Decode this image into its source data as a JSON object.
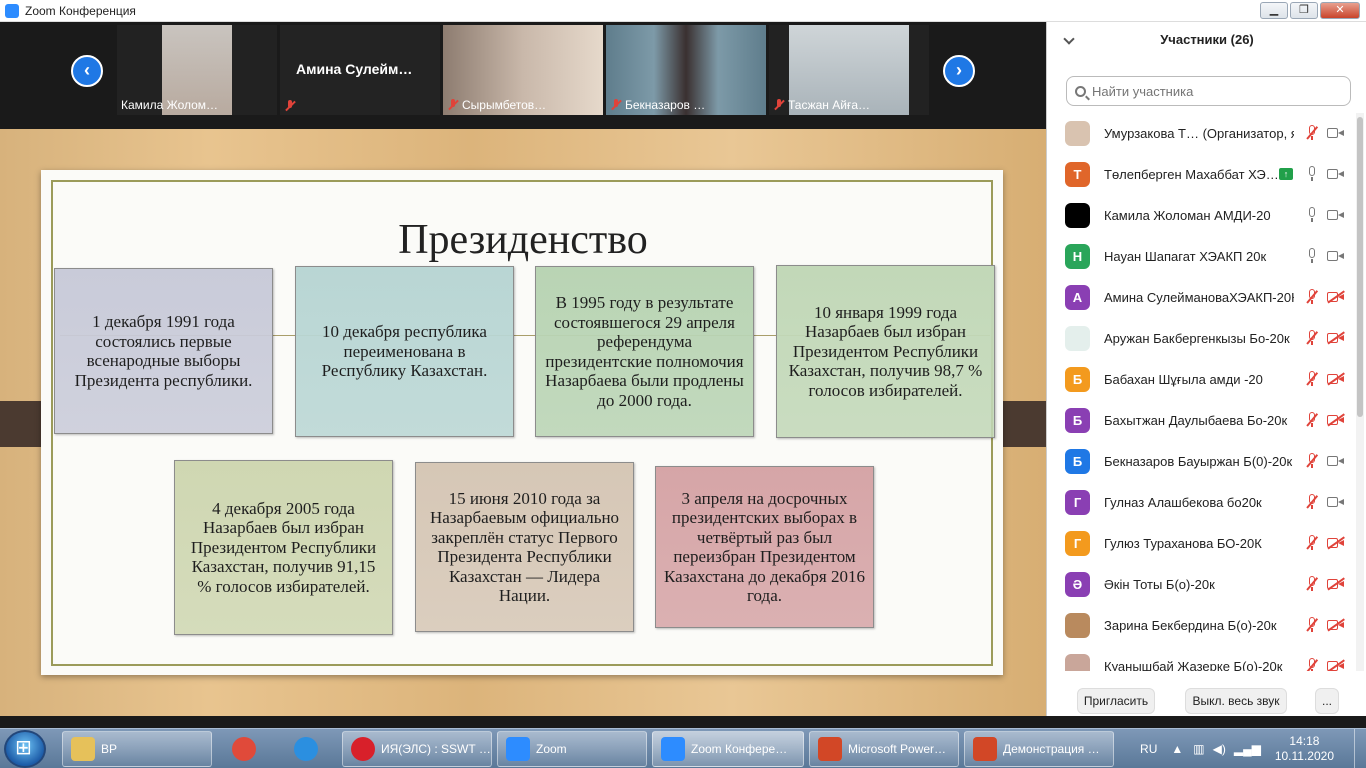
{
  "window": {
    "title": "Zoom Конференция",
    "minimize": "▁",
    "restore": "❐",
    "close": "✕"
  },
  "gallery": {
    "prev": "‹",
    "next": "›",
    "tiles": [
      {
        "name": "Камила Жолом…"
      },
      {
        "name": "Амина  Сулейм…"
      },
      {
        "name": "Сырымбетов…"
      },
      {
        "name": "Бекназаров …"
      },
      {
        "name": "Тасжан Айға…"
      }
    ]
  },
  "slide": {
    "title": "Президенство",
    "boxes": [
      "1 декабря 1991 года состоялись первые всенародные выборы Президента республики.",
      "10 декабря республика переименована в Республику Казахстан.",
      "В 1995 году в результате состоявшегося 29 апреля референдума президентские полномочия Назарбаева были продлены до 2000 года.",
      "10 января 1999 года Назарбаев был избран Президентом Республики Казахстан, получив 98,7 % голосов избирателей.",
      "4 декабря 2005 года Назарбаев был избран Президентом Республики Казахстан, получив 91,15 % голосов избирателей.",
      "15 июня 2010 года за Назарбаевым официально закреплён статус Первого Президента Республики Казахстан — Лидера Нации.",
      "3 апреля на досрочных президентских выборах в четвёртый раз был переизбран Президентом Казахстана до декабря 2016 года."
    ],
    "box_colors": [
      "#c9cbd9",
      "#b9d6d4",
      "#b9d4b4",
      "#c2d8b8",
      "#cfd7b2",
      "#d6c7b6",
      "#d6a5a7"
    ]
  },
  "participants": {
    "header": "Участники (26)",
    "search_placeholder": "Найти участника",
    "list": [
      {
        "name": "Умурзакова Т… (Организатор, я)",
        "initial": "",
        "color": "#d9c3b0",
        "mic": "off",
        "cam": "on"
      },
      {
        "name": "Төлепберген Махаббат ХЭ…",
        "initial": "Т",
        "color": "#e0662a",
        "mic": "on",
        "cam": "on",
        "hand": "↑"
      },
      {
        "name": "Камила Жоломан АМДИ-20",
        "initial": "",
        "color": "#000000",
        "mic": "on",
        "cam": "on"
      },
      {
        "name": "Науан Шапагат ХЭАКП 20к",
        "initial": "Н",
        "color": "#2aa55a",
        "mic": "on",
        "cam": "on"
      },
      {
        "name": "Амина СулеймановаХЭАКП-20К",
        "initial": "А",
        "color": "#8a3fb3",
        "mic": "off",
        "cam": "off"
      },
      {
        "name": "Аружан Бакбергенкызы Бо-20к",
        "initial": "",
        "color": "#e4efec",
        "mic": "off",
        "cam": "off"
      },
      {
        "name": "Бабахан Шұғыла амди -20",
        "initial": "Б",
        "color": "#f39a1e",
        "mic": "off",
        "cam": "off"
      },
      {
        "name": "Бахытжан Даулыбаева Бо-20к",
        "initial": "Б",
        "color": "#8a3fb3",
        "mic": "off",
        "cam": "off"
      },
      {
        "name": "Бекназаров Бауыржан Б(0)-20к",
        "initial": "Б",
        "color": "#1f78e5",
        "mic": "off",
        "cam": "on"
      },
      {
        "name": "Гулназ Алашбекова бо20к",
        "initial": "Г",
        "color": "#8a3fb3",
        "mic": "off",
        "cam": "on"
      },
      {
        "name": "Гулюз Тураханова БО-20К",
        "initial": "Г",
        "color": "#f39a1e",
        "mic": "off",
        "cam": "off"
      },
      {
        "name": "Әкін Тоты Б(о)-20к",
        "initial": "Ә",
        "color": "#8a3fb3",
        "mic": "off",
        "cam": "off"
      },
      {
        "name": "Зарина Бекбердина Б(о)-20к",
        "initial": "",
        "color": "#b98a5e",
        "mic": "off",
        "cam": "off"
      },
      {
        "name": "Куанышбай Жазерке Б(о)-20к",
        "initial": "",
        "color": "#c9a69a",
        "mic": "off",
        "cam": "off"
      }
    ],
    "invite": "Пригласить",
    "mute_all": "Выкл. весь звук",
    "more": "..."
  },
  "taskbar": {
    "items": [
      {
        "label": "BP",
        "icon_color": "#e6c15a"
      },
      {
        "label": "",
        "icon_color": "#e04a3a"
      },
      {
        "label": "",
        "icon_color": "#2b8fe0"
      },
      {
        "label": "ИЯ(ЭЛС) : SSWT …",
        "icon_color": "#d8202a"
      },
      {
        "label": "Zoom",
        "icon_color": "#2d8cff"
      },
      {
        "label": "Zoom Конфере…",
        "icon_color": "#2d8cff"
      },
      {
        "label": "Microsoft Power…",
        "icon_color": "#d24726"
      },
      {
        "label": "Демонстрация …",
        "icon_color": "#d24726"
      }
    ],
    "lang": "RU",
    "time": "14:18",
    "date": "10.11.2020"
  }
}
